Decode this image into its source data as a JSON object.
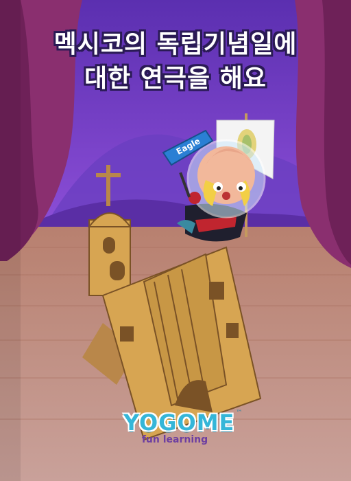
{
  "title": {
    "line1": "멕시코의 독립기념일에",
    "line2": "대한 연극을 해요"
  },
  "character": {
    "badge_text": "Eagle"
  },
  "brand": {
    "name": "YOGOME",
    "tm": "™",
    "tagline": "fun learning"
  },
  "colors": {
    "curtain": "#8a2f6f",
    "sky": "#7b46c9",
    "stage_floor": "#b9857a",
    "church": "#d7a552",
    "brand_blue": "#35b6d8",
    "brand_purple": "#6d3fa1"
  }
}
